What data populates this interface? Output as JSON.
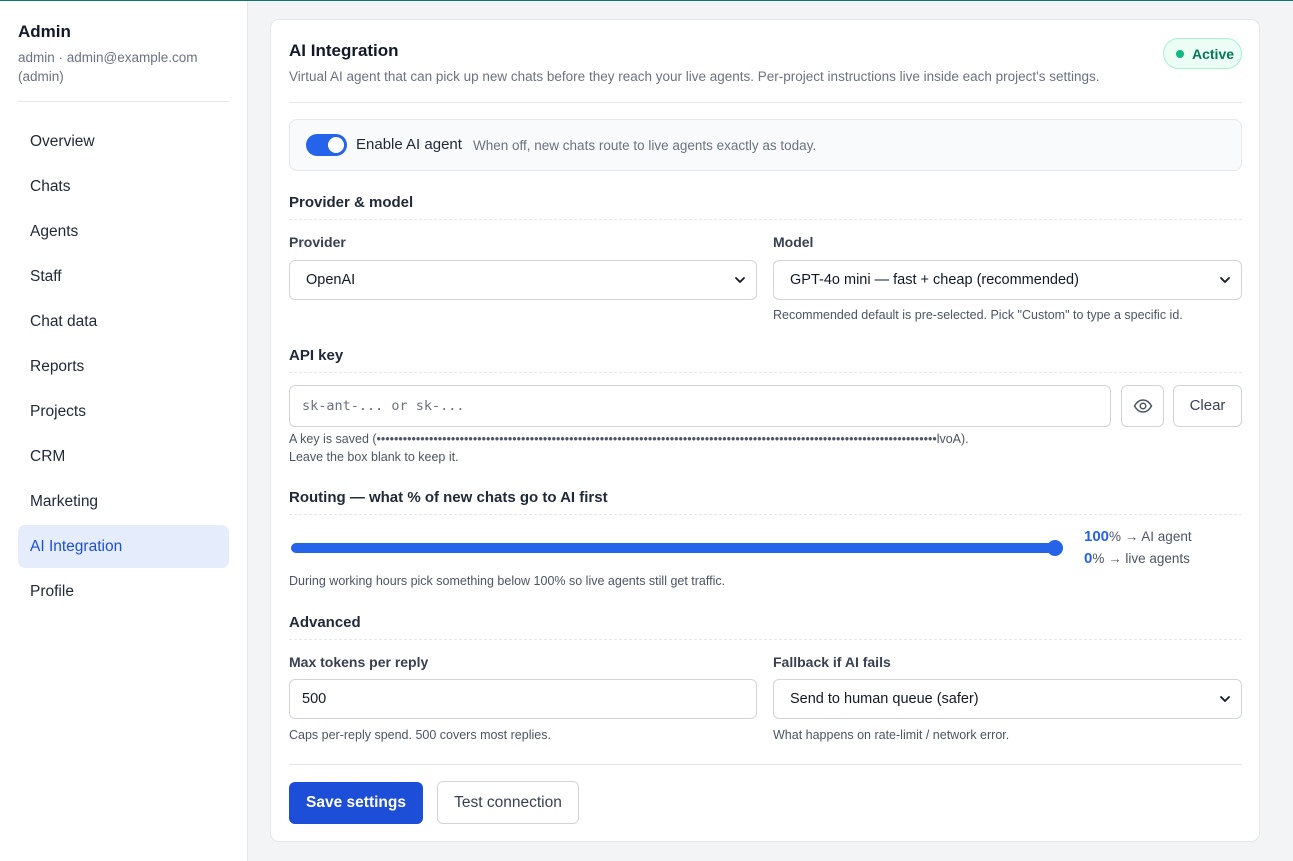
{
  "sidebar": {
    "title": "Admin",
    "subtitle": "admin · admin@example.com (admin)",
    "items": [
      {
        "label": "Overview"
      },
      {
        "label": "Chats"
      },
      {
        "label": "Agents"
      },
      {
        "label": "Staff"
      },
      {
        "label": "Chat data"
      },
      {
        "label": "Reports"
      },
      {
        "label": "Projects"
      },
      {
        "label": "CRM"
      },
      {
        "label": "Marketing"
      },
      {
        "label": "AI Integration",
        "active": true
      },
      {
        "label": "Profile"
      }
    ]
  },
  "card": {
    "title": "AI Integration",
    "description": "Virtual AI agent that can pick up new chats before they reach your live agents. Per-project instructions live inside each project's settings.",
    "status_badge": "Active"
  },
  "toggle": {
    "label": "Enable AI agent",
    "hint": "When off, new chats route to live agents exactly as today.",
    "enabled": true
  },
  "provider_section": {
    "title": "Provider & model",
    "provider_label": "Provider",
    "provider_value": "OpenAI",
    "model_label": "Model",
    "model_value": "GPT-4o mini — fast + cheap (recommended)",
    "model_help": "Recommended default is pre-selected. Pick \"Custom\" to type a specific id."
  },
  "api_key": {
    "title": "API key",
    "placeholder": "sk-ant-... or sk-...",
    "clear_label": "Clear",
    "saved_note_line1": "A key is saved (••••••••••••••••••••••••••••••••••••••••••••••••••••••••••••••••••••••••••••••••••••••••••••••••••••••••••••••••••••••••••••••••lvoA).",
    "saved_note_line2": "Leave the box blank to keep it."
  },
  "routing": {
    "title": "Routing — what % of new chats go to AI first",
    "ai_percent": 100,
    "ai_percent_text": "100",
    "ai_suffix": "% → AI agent",
    "live_percent_text": "0",
    "live_suffix": "% → live agents",
    "help": "During working hours pick something below 100% so live agents still get traffic."
  },
  "advanced": {
    "title": "Advanced",
    "max_tokens_label": "Max tokens per reply",
    "max_tokens_value": "500",
    "max_tokens_help": "Caps per-reply spend. 500 covers most replies.",
    "fallback_label": "Fallback if AI fails",
    "fallback_value": "Send to human queue (safer)",
    "fallback_help": "What happens on rate-limit / network error."
  },
  "actions": {
    "save_label": "Save settings",
    "test_label": "Test connection"
  },
  "colors": {
    "accent": "#2563eb",
    "primary_button": "#1d4ed8",
    "active_badge": "#047857",
    "active_nav_bg": "#e5edfd"
  },
  "icons": {
    "show_key": "eye-icon",
    "dropdown": "chevron-down-icon"
  }
}
